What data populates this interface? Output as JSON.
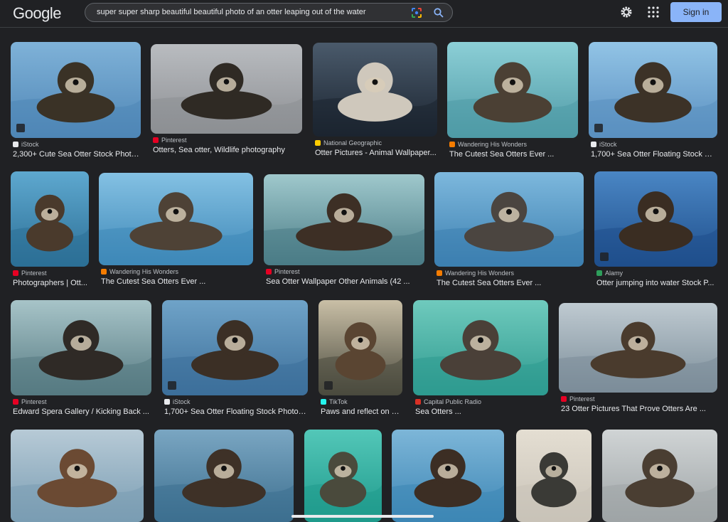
{
  "header": {
    "logo": "Google",
    "query": "super super sharp beautiful beautiful photo of an otter leaping out of the water",
    "sign_in": "Sign in"
  },
  "colors": {
    "background": "#202124",
    "accent": "#8ab4f8"
  },
  "icons": [
    "lens-icon",
    "search-icon",
    "gear-icon",
    "apps-grid-icon"
  ],
  "rows": [
    [
      {
        "source": "iStock",
        "title": "2,300+ Cute Sea Otter Stock Photo..."
      },
      {
        "source": "Pinterest",
        "title": "Otters, Sea otter, Wildlife photography"
      },
      {
        "source": "National Geographic",
        "title": "Otter Pictures - Animal Wallpaper..."
      },
      {
        "source": "Wandering His Wonders",
        "title": "The Cutest Sea Otters Ever ..."
      },
      {
        "source": "iStock",
        "title": "1,700+ Sea Otter Floating Stock Ph..."
      }
    ],
    [
      {
        "source": "Pinterest",
        "title": "Photographers | Ott..."
      },
      {
        "source": "Wandering His Wonders",
        "title": "The Cutest Sea Otters Ever ..."
      },
      {
        "source": "Pinterest",
        "title": "Sea Otter Wallpaper Other Animals (42 ..."
      },
      {
        "source": "Wandering His Wonders",
        "title": "The Cutest Sea Otters Ever ..."
      },
      {
        "source": "Alamy",
        "title": "Otter jumping into water Stock P..."
      }
    ],
    [
      {
        "source": "Pinterest",
        "title": "Edward Spera Gallery / Kicking Back ..."
      },
      {
        "source": "iStock",
        "title": "1,700+ Sea Otter Floating Stock Photos ..."
      },
      {
        "source": "TikTok",
        "title": "Paws and reflect on a..."
      },
      {
        "source": "Capital Public Radio",
        "title": "Sea Otters ..."
      },
      {
        "source": "Pinterest",
        "title": "23 Otter Pictures That Prove Otters Are ..."
      }
    ]
  ]
}
